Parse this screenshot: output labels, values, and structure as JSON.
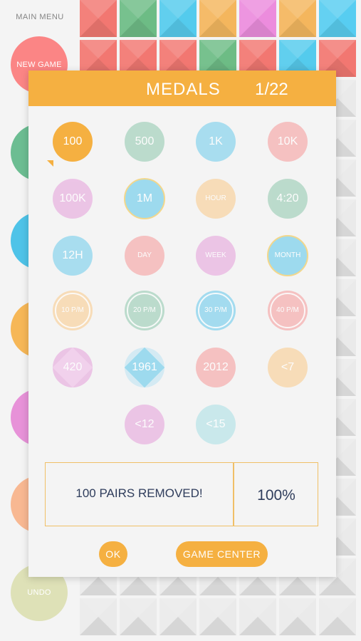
{
  "menu": {
    "title": "MAIN MENU",
    "buttons": [
      {
        "label": "NEW GAME",
        "color": "#fb6b6b"
      },
      {
        "label": "",
        "color": "#4caf7a"
      },
      {
        "label": "",
        "color": "#29b6e3"
      },
      {
        "label": "",
        "color": "#f5a833"
      },
      {
        "label": "",
        "color": "#e27bd0"
      },
      {
        "label": "",
        "color": "#f7a97a"
      },
      {
        "label": "UNDO",
        "color": "#d7dba8"
      }
    ]
  },
  "board": {
    "colors": [
      "#f05a52",
      "#4dae6b",
      "#2fc0ea",
      "#f2a73a",
      "#e873d6",
      "#f2a73a",
      "#33c3ee",
      "#f05a52",
      "#f05a52",
      "#f05a52",
      "#4dae6b",
      "#f05a52",
      "#2fc0ea",
      "#f05a52",
      "#f05a52"
    ]
  },
  "dialog": {
    "title": "MEDALS",
    "count": "1/22",
    "accent": "#f5b041",
    "medals": [
      {
        "label": "100",
        "color": "#f5b041",
        "opacity": 1,
        "pointer": true
      },
      {
        "label": "500",
        "color": "#a9d3bf",
        "opacity": 0.75
      },
      {
        "label": "1K",
        "color": "#8fd6ee",
        "opacity": 0.75
      },
      {
        "label": "10K",
        "color": "#f6b0b0",
        "opacity": 0.75
      },
      {
        "label": "100K",
        "color": "#e9b4e1",
        "opacity": 0.75
      },
      {
        "label": "1M",
        "color": "#8fd6ee",
        "opacity": 0.85,
        "outer": true
      },
      {
        "label": "HOUR",
        "color": "#f8d4a4",
        "opacity": 0.75,
        "small": true
      },
      {
        "label": "4:20",
        "color": "#a9d3bf",
        "opacity": 0.75
      },
      {
        "label": "12H",
        "color": "#8fd6ee",
        "opacity": 0.75
      },
      {
        "label": "DAY",
        "color": "#f6b0b0",
        "opacity": 0.75,
        "small": true
      },
      {
        "label": "WEEK",
        "color": "#e9b4e1",
        "opacity": 0.75,
        "small": true
      },
      {
        "label": "MONTH",
        "color": "#8fd6ee",
        "opacity": 0.85,
        "outer": true,
        "small": true
      },
      {
        "label": "10 P/M",
        "color": "#f8d4a4",
        "opacity": 0.75,
        "small": true,
        "ring": true
      },
      {
        "label": "20 P/M",
        "color": "#a9d3bf",
        "opacity": 0.75,
        "small": true,
        "ring": true
      },
      {
        "label": "30 P/M",
        "color": "#8fd6ee",
        "opacity": 0.8,
        "small": true,
        "ring": true
      },
      {
        "label": "40 P/M",
        "color": "#f6b0b0",
        "opacity": 0.75,
        "small": true,
        "ring": true
      },
      {
        "label": "420",
        "color": "#e9b4e1",
        "opacity": 0.75,
        "diamond": "#f0c6ea"
      },
      {
        "label": "1961",
        "color": "#cfe9f3",
        "opacity": 0.85,
        "diamond": "#8fd6ee"
      },
      {
        "label": "2012",
        "color": "#f6b0b0",
        "opacity": 0.75
      },
      {
        "label": "<7",
        "color": "#f8d4a4",
        "opacity": 0.75
      },
      {
        "label": "<12",
        "color": "#e9b4e1",
        "opacity": 0.75
      },
      {
        "label": "<15",
        "color": "#bfe6ea",
        "opacity": 0.8
      }
    ],
    "info_text": "100 PAIRS REMOVED!",
    "info_pct": "100%",
    "ok_label": "OK",
    "gc_label": "GAME CENTER"
  }
}
